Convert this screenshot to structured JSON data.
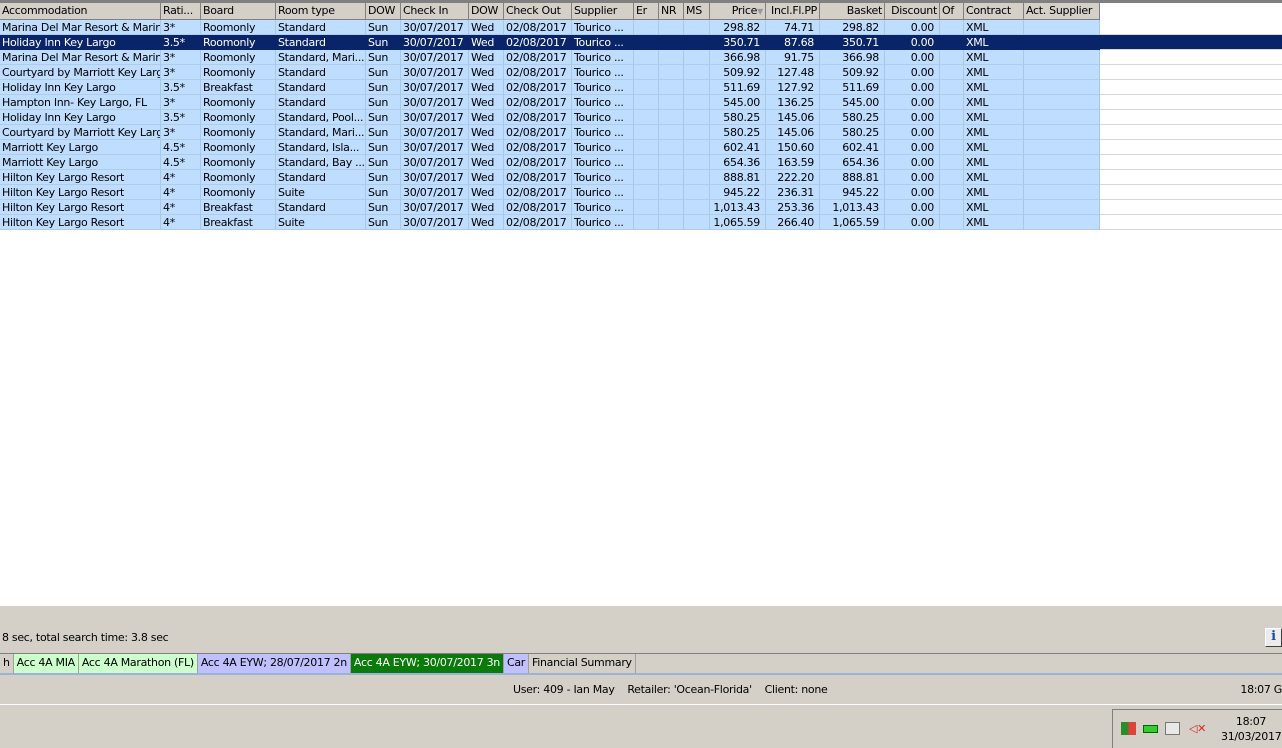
{
  "columns": [
    "Accommodation",
    "Rati...",
    "Board",
    "Room type",
    "DOW",
    "Check In",
    "DOW",
    "Check Out",
    "Supplier",
    "Er",
    "NR",
    "MS",
    "Price",
    "Incl.Fl.PP",
    "Basket",
    "Discount",
    "Of",
    "Contract",
    "Act. Supplier"
  ],
  "sort_indicator": "▼",
  "selected_row": 1,
  "rows": [
    [
      "Marina Del Mar Resort & Marina",
      "3*",
      "Roomonly",
      "Standard",
      "Sun",
      "30/07/2017",
      "Wed",
      "02/08/2017",
      "Tourico ...",
      "",
      "",
      "",
      "298.82",
      "74.71",
      "298.82",
      "0.00",
      "",
      "XML",
      ""
    ],
    [
      "Holiday Inn Key Largo",
      "3.5*",
      "Roomonly",
      "Standard",
      "Sun",
      "30/07/2017",
      "Wed",
      "02/08/2017",
      "Tourico ...",
      "",
      "",
      "",
      "350.71",
      "87.68",
      "350.71",
      "0.00",
      "",
      "XML",
      ""
    ],
    [
      "Marina Del Mar Resort & Marina",
      "3*",
      "Roomonly",
      "Standard, Mari...",
      "Sun",
      "30/07/2017",
      "Wed",
      "02/08/2017",
      "Tourico ...",
      "",
      "",
      "",
      "366.98",
      "91.75",
      "366.98",
      "0.00",
      "",
      "XML",
      ""
    ],
    [
      "Courtyard by Marriott Key Largo",
      "3*",
      "Roomonly",
      "Standard",
      "Sun",
      "30/07/2017",
      "Wed",
      "02/08/2017",
      "Tourico ...",
      "",
      "",
      "",
      "509.92",
      "127.48",
      "509.92",
      "0.00",
      "",
      "XML",
      ""
    ],
    [
      "Holiday Inn Key Largo",
      "3.5*",
      "Breakfast",
      "Standard",
      "Sun",
      "30/07/2017",
      "Wed",
      "02/08/2017",
      "Tourico ...",
      "",
      "",
      "",
      "511.69",
      "127.92",
      "511.69",
      "0.00",
      "",
      "XML",
      ""
    ],
    [
      "Hampton Inn- Key Largo, FL",
      "3*",
      "Roomonly",
      "Standard",
      "Sun",
      "30/07/2017",
      "Wed",
      "02/08/2017",
      "Tourico ...",
      "",
      "",
      "",
      "545.00",
      "136.25",
      "545.00",
      "0.00",
      "",
      "XML",
      ""
    ],
    [
      "Holiday Inn Key Largo",
      "3.5*",
      "Roomonly",
      "Standard, Pool...",
      "Sun",
      "30/07/2017",
      "Wed",
      "02/08/2017",
      "Tourico ...",
      "",
      "",
      "",
      "580.25",
      "145.06",
      "580.25",
      "0.00",
      "",
      "XML",
      ""
    ],
    [
      "Courtyard by Marriott Key Largo",
      "3*",
      "Roomonly",
      "Standard, Mari...",
      "Sun",
      "30/07/2017",
      "Wed",
      "02/08/2017",
      "Tourico ...",
      "",
      "",
      "",
      "580.25",
      "145.06",
      "580.25",
      "0.00",
      "",
      "XML",
      ""
    ],
    [
      "Marriott Key Largo",
      "4.5*",
      "Roomonly",
      "Standard, Isla...",
      "Sun",
      "30/07/2017",
      "Wed",
      "02/08/2017",
      "Tourico ...",
      "",
      "",
      "",
      "602.41",
      "150.60",
      "602.41",
      "0.00",
      "",
      "XML",
      ""
    ],
    [
      "Marriott Key Largo",
      "4.5*",
      "Roomonly",
      "Standard, Bay ...",
      "Sun",
      "30/07/2017",
      "Wed",
      "02/08/2017",
      "Tourico ...",
      "",
      "",
      "",
      "654.36",
      "163.59",
      "654.36",
      "0.00",
      "",
      "XML",
      ""
    ],
    [
      "Hilton Key Largo Resort",
      "4*",
      "Roomonly",
      "Standard",
      "Sun",
      "30/07/2017",
      "Wed",
      "02/08/2017",
      "Tourico ...",
      "",
      "",
      "",
      "888.81",
      "222.20",
      "888.81",
      "0.00",
      "",
      "XML",
      ""
    ],
    [
      "Hilton Key Largo Resort",
      "4*",
      "Roomonly",
      "Suite",
      "Sun",
      "30/07/2017",
      "Wed",
      "02/08/2017",
      "Tourico ...",
      "",
      "",
      "",
      "945.22",
      "236.31",
      "945.22",
      "0.00",
      "",
      "XML",
      ""
    ],
    [
      "Hilton Key Largo Resort",
      "4*",
      "Breakfast",
      "Standard",
      "Sun",
      "30/07/2017",
      "Wed",
      "02/08/2017",
      "Tourico ...",
      "",
      "",
      "",
      "1,013.43",
      "253.36",
      "1,013.43",
      "0.00",
      "",
      "XML",
      ""
    ],
    [
      "Hilton Key Largo Resort",
      "4*",
      "Breakfast",
      "Suite",
      "Sun",
      "30/07/2017",
      "Wed",
      "02/08/2017",
      "Tourico ...",
      "",
      "",
      "",
      "1,065.59",
      "266.40",
      "1,065.59",
      "0.00",
      "",
      "XML",
      ""
    ]
  ],
  "status_text": "8 sec, total search time: 3.8 sec",
  "info_label": "i",
  "tabs": [
    {
      "label": "h",
      "bg": "#d4d0c8",
      "fg": "#000000"
    },
    {
      "label": "Acc 4A MIA",
      "bg": "#ccffcc",
      "fg": "#000000"
    },
    {
      "label": "Acc 4A Marathon (FL)",
      "bg": "#ccffcc",
      "fg": "#000000"
    },
    {
      "label": "Acc 4A EYW; 28/07/2017 2n",
      "bg": "#c0c0ff",
      "fg": "#000000"
    },
    {
      "label": "Acc 4A EYW; 30/07/2017 3n",
      "bg": "#0a7a0a",
      "fg": "#ffffff"
    },
    {
      "label": "Car",
      "bg": "#c0c0ff",
      "fg": "#000000"
    },
    {
      "label": "Financial Summary",
      "bg": "#d4d0c8",
      "fg": "#000000"
    }
  ],
  "statusbar": {
    "user": "User: 409 - Ian May    Retailer: 'Ocean-Florida'    Client: none",
    "clock": "18:07 G"
  },
  "taskbar": {
    "time": "18:07",
    "date": "31/03/2017",
    "tray_icons": [
      "antivirus-icon",
      "network-card-icon",
      "network-icon",
      "volume-muted-icon"
    ]
  }
}
